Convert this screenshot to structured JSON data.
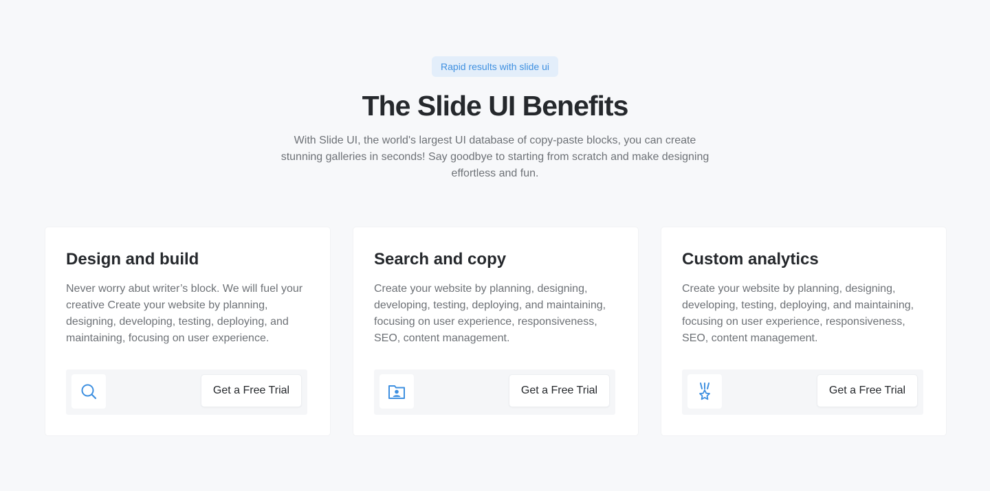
{
  "hero": {
    "badge": "Rapid results with slide ui",
    "title": "The Slide UI Benefits",
    "subtitle": "With Slide UI, the world's largest UI database of copy-paste blocks, you can create stunning galleries in seconds! Say goodbye to starting from scratch and make designing effortless and fun."
  },
  "colors": {
    "accent": "#3d8fe0",
    "badge_bg": "#e3eefa",
    "page_bg": "#f7f8fa",
    "heading": "#25282c",
    "body_text": "#6d7176"
  },
  "cards": [
    {
      "title": "Design and build",
      "text": "Never worry abut writer’s block. We will fuel your creative Create your website by planning, designing, developing, testing, deploying, and maintaining, focusing on user experience.",
      "icon": "search-icon",
      "button_label": "Get a Free Trial"
    },
    {
      "title": "Search and copy",
      "text": "Create your website by planning, designing, developing, testing, deploying, and maintaining, focusing on user experience, responsiveness, SEO, content management.",
      "icon": "folder-user-icon",
      "button_label": "Get a Free Trial"
    },
    {
      "title": "Custom analytics",
      "text": "Create your website by planning, designing, developing, testing, deploying, and maintaining, focusing on user experience, responsiveness, SEO, content management.",
      "icon": "medal-star-icon",
      "button_label": "Get a Free Trial"
    }
  ]
}
